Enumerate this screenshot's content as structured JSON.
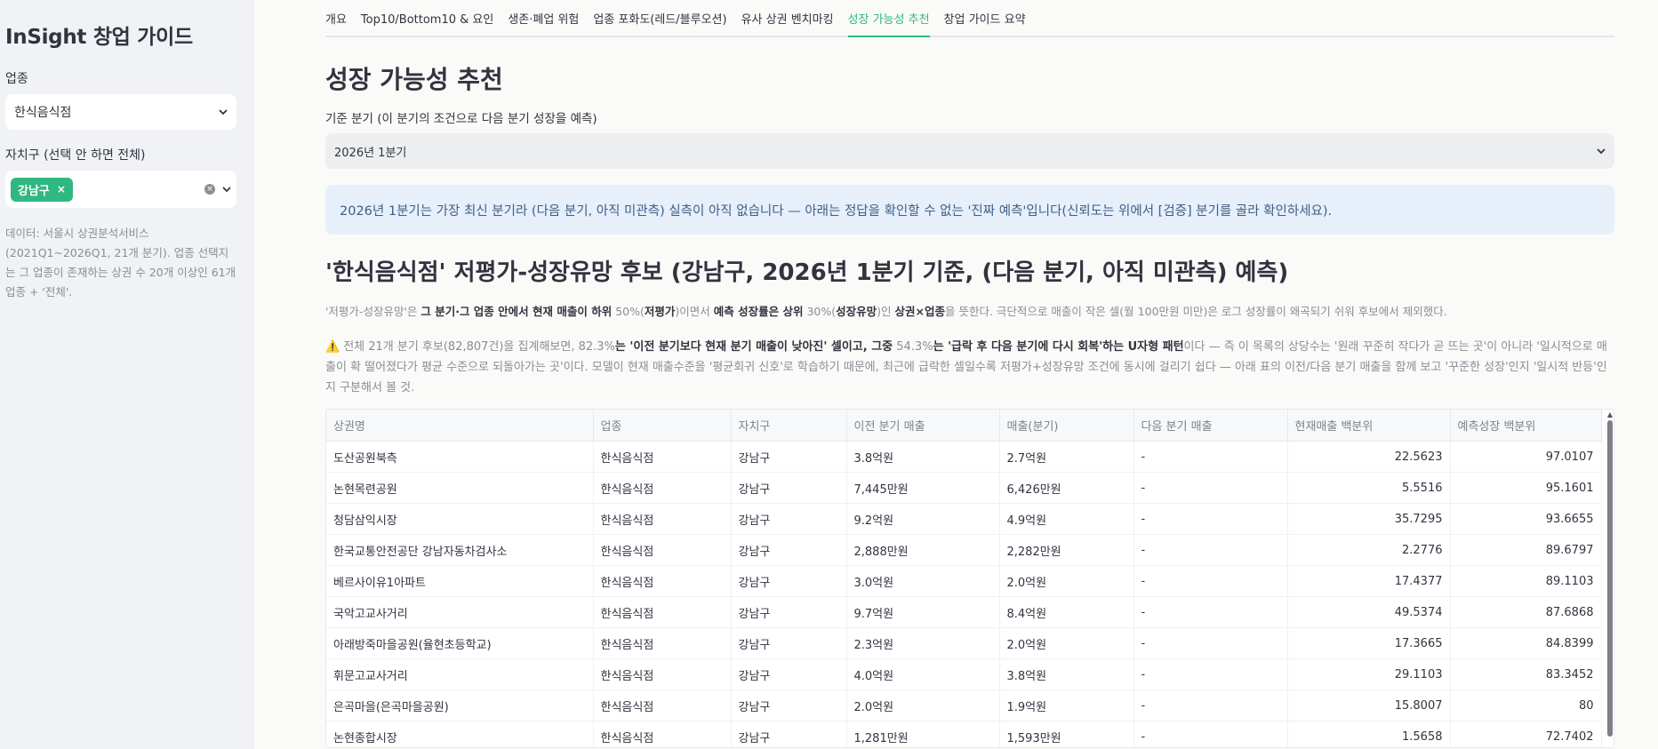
{
  "sidebar": {
    "title": "InSight 창업 가이드",
    "industry_label": "업종",
    "industry_value": "한식음식점",
    "district_label": "자치구 (선택 안 하면 전체)",
    "district_tag": "강남구",
    "note": "데이터: 서울시 상권분석서비스 (2021Q1~2026Q1, 21개 분기). 업종 선택지는 그 업종이 존재하는 상권 수 20개 이상인 61개 업종 + '전체'."
  },
  "tabs": [
    {
      "label": "개요"
    },
    {
      "label": "Top10/Bottom10 & 요인"
    },
    {
      "label": "생존·폐업 위험"
    },
    {
      "label": "업종 포화도(레드/블루오션)"
    },
    {
      "label": "유사 상권 벤치마킹"
    },
    {
      "label": "성장 가능성 추천"
    },
    {
      "label": "창업 가이드 요약"
    }
  ],
  "active_tab": "성장 가능성 추천",
  "main": {
    "page_title": "성장 가능성 추천",
    "quarter_label": "기준 분기 (이 분기의 조건으로 다음 분기 성장을 예측)",
    "quarter_value": "2026년 1분기",
    "info": "2026년 1분기는 가장 최신 분기라 (다음 분기, 아직 미관측) 실측이 아직 없습니다 — 아래는 정답을 확인할 수 없는 '진짜 예측'입니다(신뢰도는 위에서 [검증] 분기를 골라 확인하세요).",
    "section_title": "'한식음식점' 저평가-성장유망 후보 (강남구, 2026년 1분기 기준, (다음 분기, 아직 미관측) 예측)",
    "caption": {
      "p1": "'저평가-성장유망'은 ",
      "b1": "그 분기·그 업종 안에서 현재 매출이 하위",
      "p2": " 50%(",
      "b2": "저평가",
      "p3": ")이면서 ",
      "b3": "예측 성장률은 상위",
      "p4": " 30%(",
      "b4": "성장유망",
      "p5": ")인 ",
      "b5": "상권×업종",
      "p6": "을 뜻한다. 극단적으로 매출이 작은 셀(월 100만원 미만)은 로그 성장률이 왜곡되기 쉬워 후보에서 제외했다."
    },
    "warning": {
      "icon": "⚠️",
      "p1": "전체 21개 분기 후보(82,807건)을 집계해보면, 82.3%",
      "b1": "는 '이전 분기보다 현재 분기 매출이 낮아진' 셀이고, 그중",
      "p2": " 54.3%",
      "b2": "는 '급락 후 다음 분기에 다시 회복'하는 U자형 패턴",
      "p3": "이다 — 즉 이 목록의 상당수는 '원래 꾸준히 작다가 곧 뜨는 곳'이 아니라 '일시적으로 매출이 확 떨어졌다가 평균 수준으로 되돌아가는 곳'이다. 모델이 현재 매출수준을 '평균회귀 신호'로 학습하기 때문에, 최근에 급락한 셀일수록 저평가+성장유망 조건에 동시에 걸리기 쉽다 — 아래 표의 이전/다음 분기 매출을 함께 보고 '꾸준한 성장'인지 '일시적 반등'인지 구분해서 볼 것."
    }
  },
  "table": {
    "columns": [
      "상권명",
      "업종",
      "자치구",
      "이전 분기 매출",
      "매출(분기)",
      "다음 분기 매출",
      "현재매출 백분위",
      "예측성장 백분위"
    ],
    "rows": [
      [
        "도산공원북측",
        "한식음식점",
        "강남구",
        "3.8억원",
        "2.7억원",
        "-",
        "22.5623",
        "97.0107"
      ],
      [
        "논현목련공원",
        "한식음식점",
        "강남구",
        "7,445만원",
        "6,426만원",
        "-",
        "5.5516",
        "95.1601"
      ],
      [
        "청담삼익시장",
        "한식음식점",
        "강남구",
        "9.2억원",
        "4.9억원",
        "-",
        "35.7295",
        "93.6655"
      ],
      [
        "한국교통안전공단 강남자동차검사소",
        "한식음식점",
        "강남구",
        "2,888만원",
        "2,282만원",
        "-",
        "2.2776",
        "89.6797"
      ],
      [
        "베르사이유1아파트",
        "한식음식점",
        "강남구",
        "3.0억원",
        "2.0억원",
        "-",
        "17.4377",
        "89.1103"
      ],
      [
        "국악고교사거리",
        "한식음식점",
        "강남구",
        "9.7억원",
        "8.4억원",
        "-",
        "49.5374",
        "87.6868"
      ],
      [
        "아래방죽마을공원(율현초등학교)",
        "한식음식점",
        "강남구",
        "2.3억원",
        "2.0억원",
        "-",
        "17.3665",
        "84.8399"
      ],
      [
        "휘문고교사거리",
        "한식음식점",
        "강남구",
        "4.0억원",
        "3.8억원",
        "-",
        "29.1103",
        "83.3452"
      ],
      [
        "은곡마을(은곡마을공원)",
        "한식음식점",
        "강남구",
        "2.0억원",
        "1.9억원",
        "-",
        "15.8007",
        "80"
      ],
      [
        "논현종합시장",
        "한식음식점",
        "강남구",
        "1,281만원",
        "1,593만원",
        "-",
        "1.5658",
        "72.7402"
      ]
    ]
  },
  "colors": {
    "accent": "#2fb882",
    "sidebar_bg": "#f0f2f6",
    "info_bg": "#e6effa"
  }
}
